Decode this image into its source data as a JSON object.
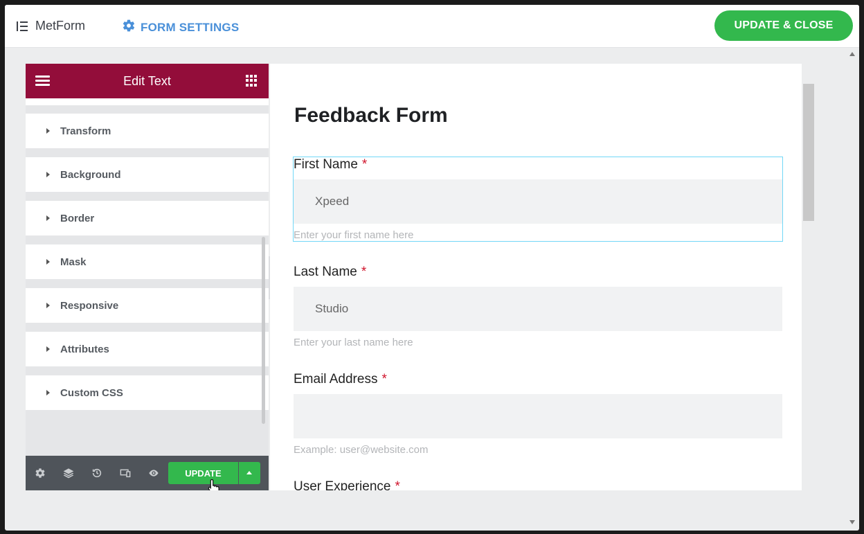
{
  "topbar": {
    "brand_name": "MetForm",
    "form_settings_label": "FORM SETTINGS",
    "update_close_label": "UPDATE & CLOSE"
  },
  "panel": {
    "title": "Edit Text",
    "sections": [
      {
        "label": "Transform"
      },
      {
        "label": "Background"
      },
      {
        "label": "Border"
      },
      {
        "label": "Mask"
      },
      {
        "label": "Responsive"
      },
      {
        "label": "Attributes"
      },
      {
        "label": "Custom CSS"
      }
    ],
    "footer": {
      "icons": [
        "settings-icon",
        "layers-icon",
        "history-icon",
        "responsive-icon",
        "preview-eye-icon"
      ],
      "update_label": "UPDATE"
    }
  },
  "preview": {
    "form_title": "Feedback Form",
    "fields": [
      {
        "label": "First Name",
        "required_mark": "*",
        "value": "Xpeed",
        "placeholder": "",
        "help": "Enter your first name here"
      },
      {
        "label": "Last Name",
        "required_mark": "*",
        "value": "Studio",
        "placeholder": "",
        "help": "Enter your last name here"
      },
      {
        "label": "Email Address",
        "required_mark": "*",
        "value": "",
        "placeholder": "",
        "help": "Example: user@website.com"
      },
      {
        "label": "User Experience",
        "required_mark": "*"
      }
    ]
  },
  "colors": {
    "panel_header": "#930d3a",
    "accent_green": "#33b84d",
    "link_blue": "#4a90d9",
    "selection_outline": "#71d7f7",
    "required_red": "#d0142c"
  }
}
